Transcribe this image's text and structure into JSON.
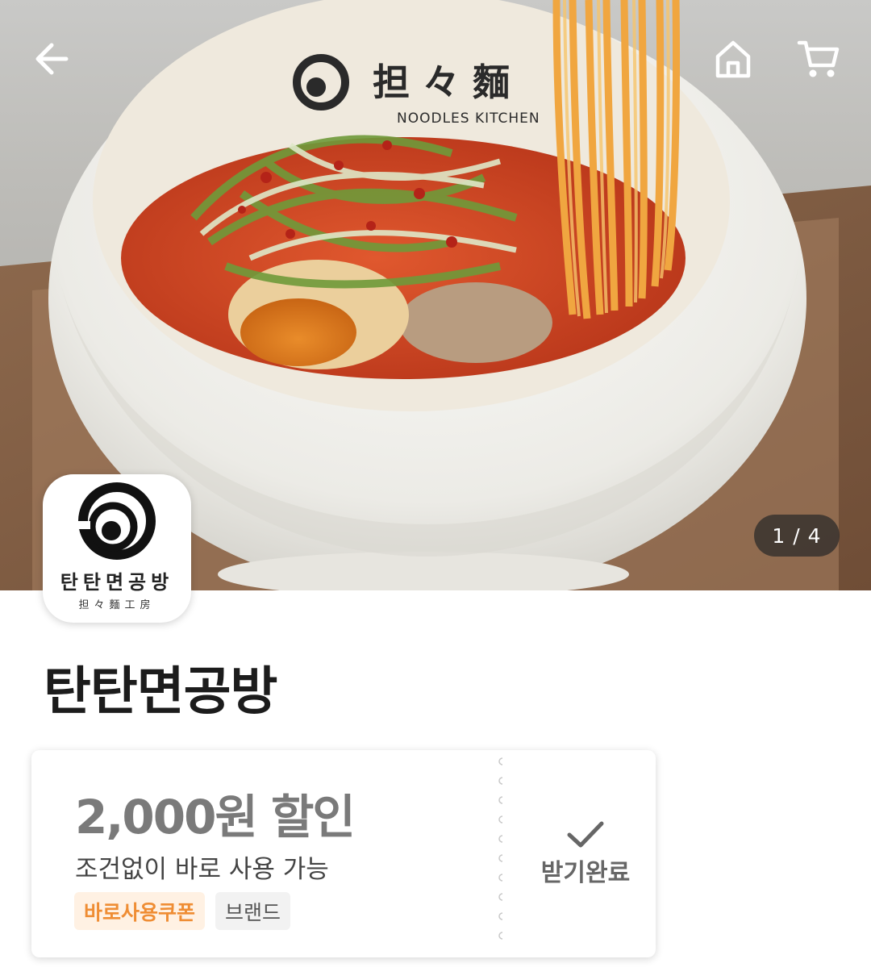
{
  "header": {
    "back_icon": "arrow-left-icon",
    "home_icon": "home-icon",
    "cart_icon": "cart-icon"
  },
  "gallery": {
    "current": "1",
    "total": "4",
    "indicator": "1 / 4",
    "bowl_text": "NOODLES KITCHEN"
  },
  "brand": {
    "logo_korean": "탄탄면공방",
    "logo_hanja": "担々麵工房",
    "name": "탄탄면공방"
  },
  "coupon": {
    "amount": "2,000원 할인",
    "description": "조건없이 바로 사용 가능",
    "tags": [
      "바로사용쿠폰",
      "브랜드"
    ],
    "claim_label": "받기완료",
    "claim_icon": "check-icon"
  },
  "colors": {
    "tag_accent": "#ef8d34",
    "tag_accent_bg": "#fff1e3"
  }
}
